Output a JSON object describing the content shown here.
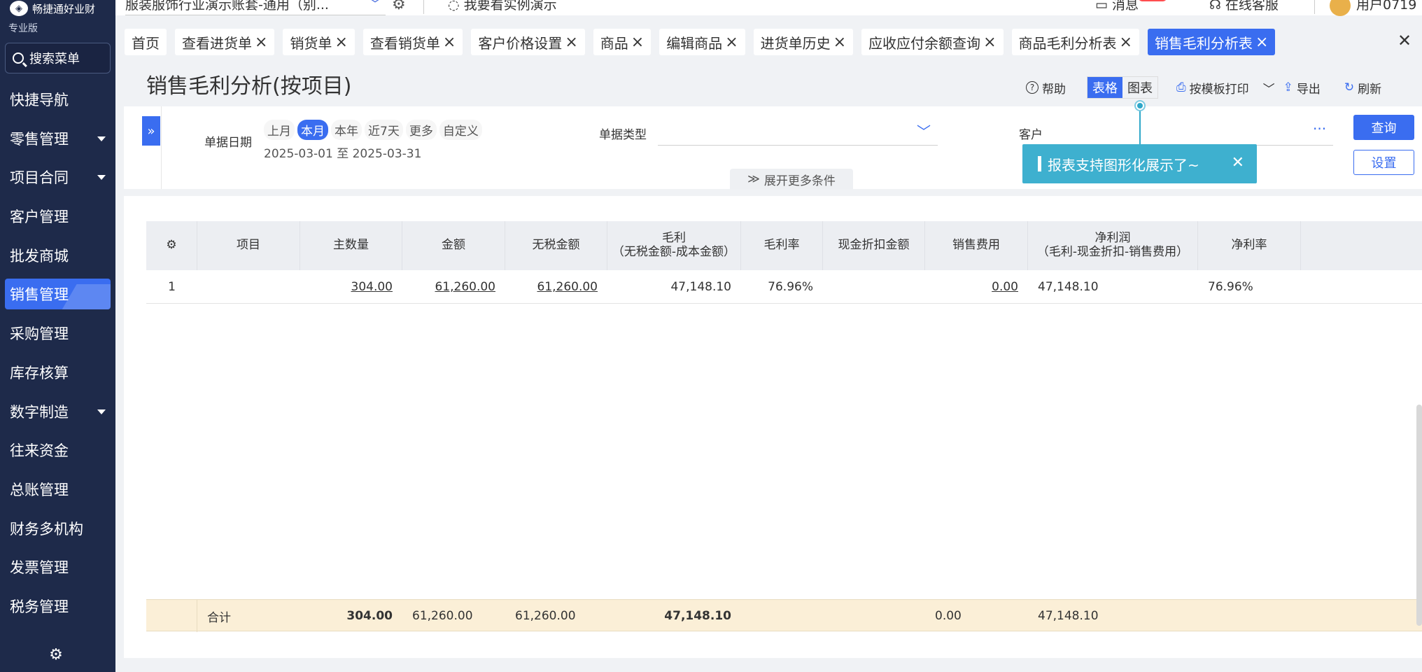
{
  "brand": {
    "name": "畅捷通好业财",
    "edition": "专业版"
  },
  "sidebar": {
    "search_label": "搜索菜单",
    "items": [
      {
        "label": "快捷导航",
        "has_caret": false
      },
      {
        "label": "零售管理",
        "has_caret": true
      },
      {
        "label": "项目合同",
        "has_caret": true
      },
      {
        "label": "客户管理",
        "has_caret": false
      },
      {
        "label": "批发商城",
        "has_caret": false
      },
      {
        "label": "销售管理",
        "has_caret": false,
        "active": true
      },
      {
        "label": "采购管理",
        "has_caret": false
      },
      {
        "label": "库存核算",
        "has_caret": false
      },
      {
        "label": "数字制造",
        "has_caret": true
      },
      {
        "label": "往来资金",
        "has_caret": false
      },
      {
        "label": "总账管理",
        "has_caret": false
      },
      {
        "label": "财务多机构",
        "has_caret": false
      },
      {
        "label": "发票管理",
        "has_caret": false
      },
      {
        "label": "税务管理",
        "has_caret": false
      }
    ]
  },
  "topbar": {
    "account": "服装服饰行业演示账套-通用（别...",
    "demo_link": "我要看实例演示",
    "messages": "消息",
    "online_service": "在线客服",
    "user": "用户0719"
  },
  "tabs": [
    {
      "label": "首页",
      "closable": false
    },
    {
      "label": "查看进货单",
      "closable": true
    },
    {
      "label": "销货单",
      "closable": true
    },
    {
      "label": "查看销货单",
      "closable": true
    },
    {
      "label": "客户价格设置",
      "closable": true
    },
    {
      "label": "商品",
      "closable": true
    },
    {
      "label": "编辑商品",
      "closable": true
    },
    {
      "label": "进货单历史",
      "closable": true
    },
    {
      "label": "应收应付余额查询",
      "closable": true
    },
    {
      "label": "商品毛利分析表",
      "closable": true
    },
    {
      "label": "销售毛利分析表",
      "closable": true,
      "active": true
    }
  ],
  "page": {
    "title": "销售毛利分析(按项目)",
    "actions": {
      "help": "帮助",
      "view_table": "表格",
      "view_chart": "图表",
      "print": "按模板打印",
      "export": "导出",
      "refresh": "刷新"
    }
  },
  "filters": {
    "date_label": "单据日期",
    "date_options": [
      "上月",
      "本月",
      "本年",
      "近7天",
      "更多",
      "自定义"
    ],
    "date_selected": "本月",
    "date_range": "2025-03-01 至 2025-03-31",
    "doc_type_label": "单据类型",
    "doc_type_value": "",
    "customer_label": "客户",
    "customer_value": "",
    "expand_label": "展开更多条件",
    "query_button": "查询",
    "settings_button": "设置"
  },
  "tooltip": {
    "text": "报表支持图形化展示了~"
  },
  "table": {
    "columns": [
      {
        "line1": "",
        "line2": ""
      },
      {
        "line1": "项目",
        "line2": ""
      },
      {
        "line1": "主数量",
        "line2": ""
      },
      {
        "line1": "金额",
        "line2": ""
      },
      {
        "line1": "无税金额",
        "line2": ""
      },
      {
        "line1": "毛利",
        "line2": "（无税金额-成本金额）"
      },
      {
        "line1": "毛利率",
        "line2": ""
      },
      {
        "line1": "现金折扣金额",
        "line2": ""
      },
      {
        "line1": "销售费用",
        "line2": ""
      },
      {
        "line1": "净利润",
        "line2": "（毛利-现金折扣-销售费用）"
      },
      {
        "line1": "净利率",
        "line2": ""
      }
    ],
    "rows": [
      {
        "index": "1",
        "project": "",
        "qty": "304.00",
        "amount": "61,260.00",
        "amount_no_tax": "61,260.00",
        "gross_profit": "47,148.10",
        "gross_margin": "76.96%",
        "cash_discount": "",
        "sales_expense": "0.00",
        "net_profit": "47,148.10",
        "net_margin": "76.96%"
      }
    ],
    "total": {
      "label": "合计",
      "qty": "304.00",
      "amount": "61,260.00",
      "amount_no_tax": "61,260.00",
      "gross_profit": "47,148.10",
      "sales_expense": "0.00",
      "net_profit": "47,148.10"
    }
  },
  "colors": {
    "primary": "#3a6df0",
    "sidebar": "#1e2a4a",
    "tooltip": "#3eb0cf",
    "total_row": "#fbefd7"
  }
}
